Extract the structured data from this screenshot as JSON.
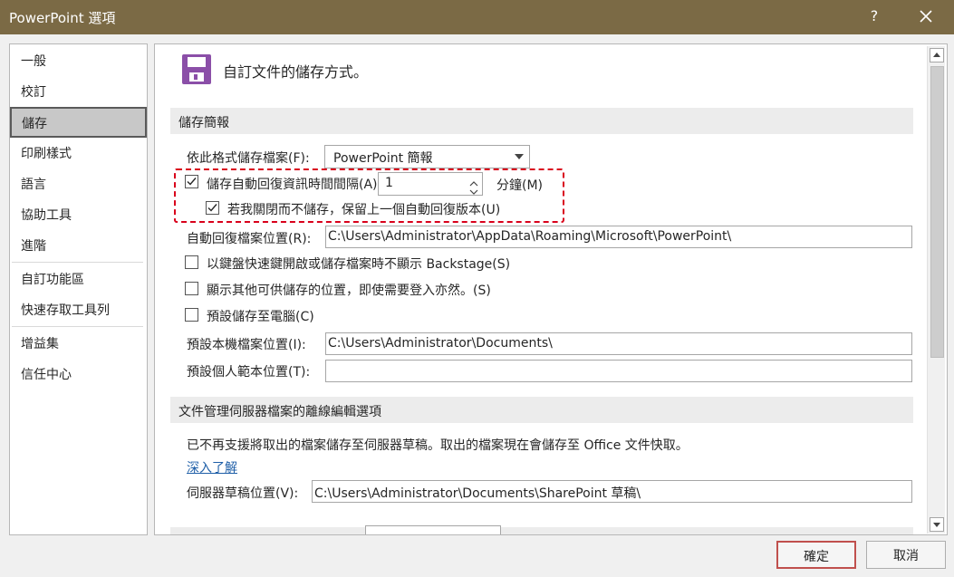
{
  "window": {
    "title": "PowerPoint 選項",
    "help_label": "?",
    "close_icon": "close-icon"
  },
  "nav": {
    "items": [
      "一般",
      "校訂",
      "儲存",
      "印刷樣式",
      "語言",
      "協助工具",
      "進階",
      "自訂功能區",
      "快速存取工具列",
      "增益集",
      "信任中心"
    ],
    "selected": "儲存"
  },
  "content": {
    "heading": "自訂文件的儲存方式。",
    "save_section": {
      "title": "儲存簡報",
      "format_label": "依此格式儲存檔案(F):",
      "format_value": "PowerPoint 簡報",
      "autorecover_label": "儲存自動回復資訊時間間隔(A):",
      "autorecover_checked": true,
      "autorecover_minutes": "1",
      "minutes_label": "分鐘(M)",
      "keep_last_label": "若我關閉而不儲存，保留上一個自動回復版本(U)",
      "keep_last_checked": true,
      "autorecover_location_label": "自動回復檔案位置(R):",
      "autorecover_location_value": "C:\\Users\\Administrator\\AppData\\Roaming\\Microsoft\\PowerPoint\\",
      "backstage_label": "以鍵盤快速鍵開啟或儲存檔案時不顯示 Backstage(S)",
      "backstage_checked": false,
      "show_other_label": "顯示其他可供儲存的位置，即使需要登入亦然。(S)",
      "show_other_checked": false,
      "default_pc_label": "預設儲存至電腦(C)",
      "default_pc_checked": false,
      "default_local_label": "預設本機檔案位置(I):",
      "default_local_value": "C:\\Users\\Administrator\\Documents\\",
      "default_template_label": "預設個人範本位置(T):",
      "default_template_value": ""
    },
    "offline_section": {
      "title": "文件管理伺服器檔案的離線編輯選項",
      "notice": "已不再支援將取出的檔案儲存至伺服器草稿。取出的檔案現在會儲存至 Office 文件快取。",
      "learn_more": "深入了解",
      "drafts_label": "伺服器草稿位置(V):",
      "drafts_value": "C:\\Users\\Administrator\\Documents\\SharePoint 草稿\\"
    }
  },
  "buttons": {
    "ok": "確定",
    "cancel": "取消"
  },
  "colors": {
    "titlebar": "#7b6a45",
    "highlight": "#d9001b",
    "save_icon": "#8b4fa8",
    "link": "#1f5fa8"
  }
}
